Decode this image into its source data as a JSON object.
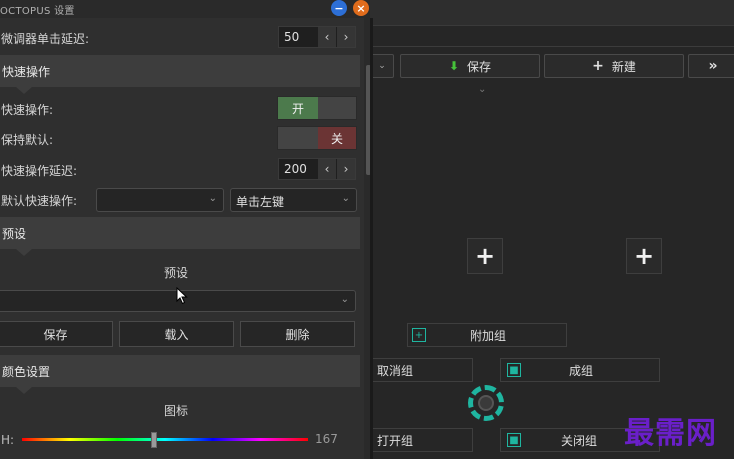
{
  "window": {
    "title": "OCTOPUS 设置"
  },
  "settings": {
    "fine_tune_label": "微调器单击延迟:",
    "fine_tune_value": "50"
  },
  "quick_ops": {
    "section_title": "快速操作",
    "enable_label": "快速操作:",
    "enable_state": "开",
    "keep_default_label": "保持默认:",
    "keep_default_state": "关",
    "delay_label": "快速操作延迟:",
    "delay_value": "200",
    "default_label": "默认快速操作:",
    "default_combo_value": "",
    "default_action": "单击左键"
  },
  "presets": {
    "section_title": "预设",
    "heading": "预设",
    "combo_value": "",
    "save_label": "保存",
    "load_label": "载入",
    "delete_label": "删除"
  },
  "colors": {
    "section_title": "颜色设置",
    "heading": "图标",
    "hue_label": "H:",
    "hue_value": "167",
    "hue_fraction": 0.46
  },
  "toolbar": {
    "save_label": "保存",
    "new_label": "新建",
    "more_label": "»"
  },
  "groups": {
    "add_group": "附加组",
    "cancel_group": "取消组",
    "make_group": "成组",
    "open_group": "打开组",
    "close_group": "关闭组"
  },
  "watermark": "最需网"
}
